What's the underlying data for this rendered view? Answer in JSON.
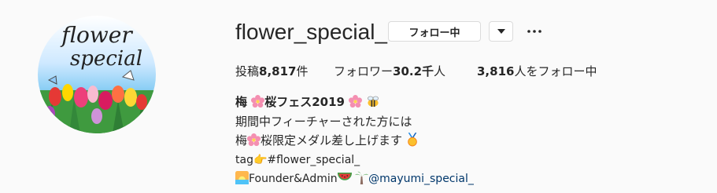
{
  "profile": {
    "username": "flower_special_",
    "avatar_text_line1": "flower",
    "avatar_text_line2": "special",
    "follow_button": "フォロー中",
    "dropdown_icon": "caret-down-icon",
    "more_icon": "more-options-icon"
  },
  "stats": {
    "posts_label": "投稿",
    "posts_value": "8,817",
    "posts_unit": "件",
    "followers_label": "フォロワー",
    "followers_value": "30.2千",
    "followers_unit": "人",
    "following_value": "3,816",
    "following_label": "人をフォロー中"
  },
  "bio": {
    "name_part1": "梅",
    "name_part2": "桜フェス2019",
    "line1": "期間中フィーチャーされた方には",
    "line2_part1": "梅",
    "line2_part2": "桜限定メダル差し上げます",
    "line3": "tag👉#flower_special_",
    "line4_part1": "Founder&Admin",
    "line4_handle": "@mayumi_special_"
  },
  "colors": {
    "background": "#fafafa",
    "text": "#262626",
    "border": "#dbdbdb",
    "link": "#00376b"
  }
}
